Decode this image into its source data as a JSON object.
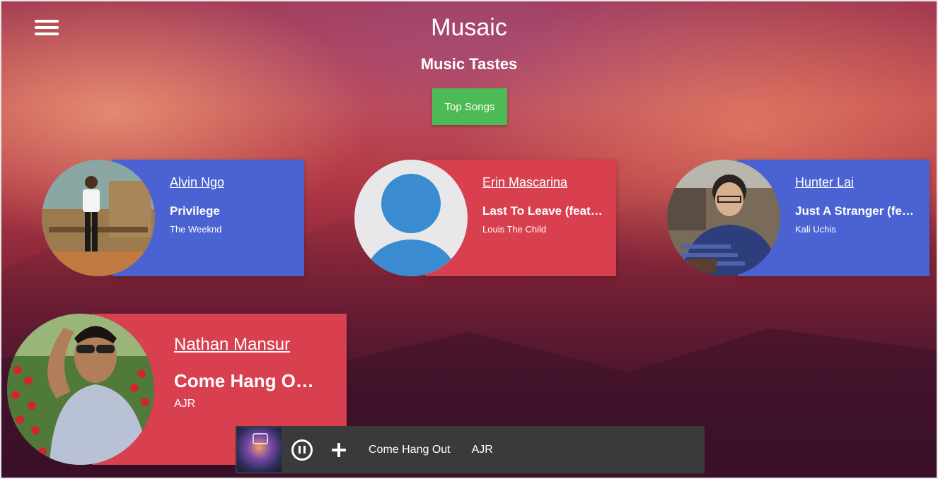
{
  "header": {
    "app_title": "Musaic",
    "subtitle": "Music Tastes",
    "top_songs_button": "Top Songs"
  },
  "cards": [
    {
      "user": "Alvin Ngo",
      "song": "Privilege",
      "artist": "The Weeknd",
      "color": "#4a62d2"
    },
    {
      "user": "Erin Mascarina",
      "song": "Last To Leave (feat…",
      "artist": "Louis The Child",
      "color": "#d84050"
    },
    {
      "user": "Hunter Lai",
      "song": "Just A Stranger (fe…",
      "artist": "Kali Uchis",
      "color": "#4a62d2"
    },
    {
      "user": "Nathan Mansur",
      "song": "Come Hang O…",
      "artist": "AJR",
      "color": "#d84050"
    }
  ],
  "player": {
    "track_title": "Come Hang Out",
    "track_artist": "AJR",
    "state": "playing"
  },
  "colors": {
    "accent_green": "#4cbb56",
    "card_blue": "#4a62d2",
    "card_red": "#d84050",
    "player_bg": "#3a3a3a"
  }
}
